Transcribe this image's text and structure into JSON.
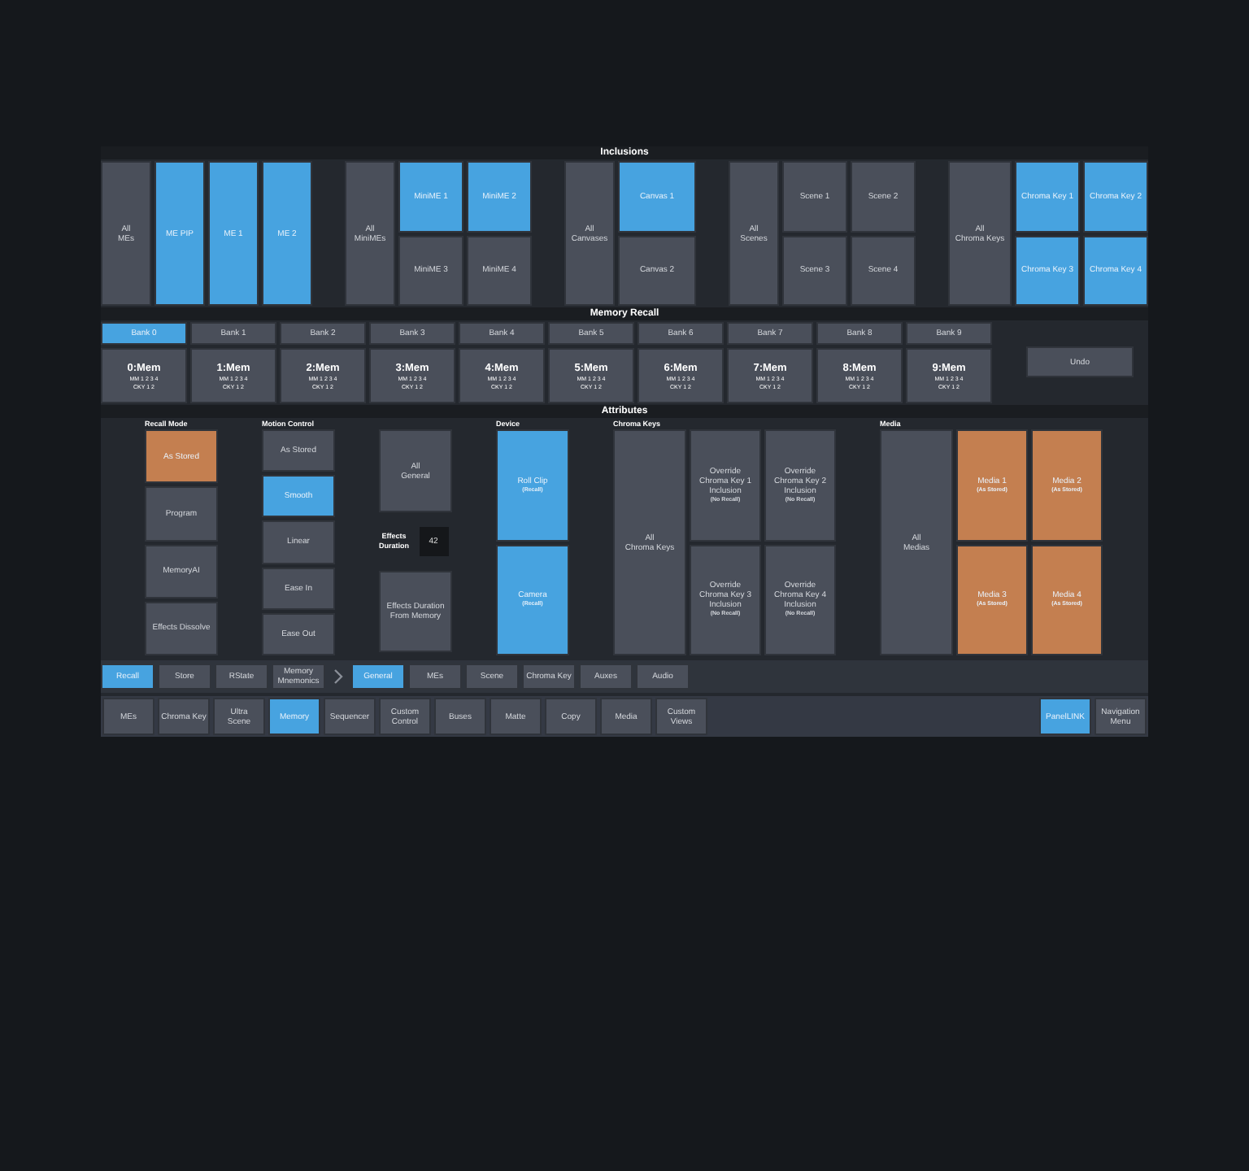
{
  "inclusions": {
    "title": "Inclusions",
    "groups": [
      {
        "kind": "columns",
        "all": "All\nMEs",
        "items": [
          {
            "label": "ME PIP",
            "selected": true
          },
          {
            "label": "ME 1",
            "selected": true
          },
          {
            "label": "ME 2",
            "selected": true
          }
        ]
      },
      {
        "kind": "grid",
        "all": "All\nMiniMEs",
        "items": [
          {
            "label": "MiniME 1",
            "selected": true
          },
          {
            "label": "MiniME 2",
            "selected": true
          },
          {
            "label": "MiniME 3",
            "selected": false
          },
          {
            "label": "MiniME 4",
            "selected": false
          }
        ]
      },
      {
        "kind": "column",
        "all": "All\nCanvases",
        "items": [
          {
            "label": "Canvas 1",
            "selected": true
          },
          {
            "label": "Canvas 2",
            "selected": false
          }
        ]
      },
      {
        "kind": "grid",
        "all": "All\nScenes",
        "items": [
          {
            "label": "Scene 1",
            "selected": false
          },
          {
            "label": "Scene 2",
            "selected": false
          },
          {
            "label": "Scene 3",
            "selected": false
          },
          {
            "label": "Scene 4",
            "selected": false
          }
        ]
      },
      {
        "kind": "grid",
        "all": "All\nChroma Keys",
        "items": [
          {
            "label": "Chroma Key 1",
            "selected": true
          },
          {
            "label": "Chroma Key 2",
            "selected": true
          },
          {
            "label": "Chroma Key 3",
            "selected": true
          },
          {
            "label": "Chroma Key 4",
            "selected": true
          }
        ]
      }
    ]
  },
  "memory_recall": {
    "title": "Memory Recall",
    "banks": [
      {
        "label": "Bank 0",
        "selected": true
      },
      {
        "label": "Bank 1",
        "selected": false
      },
      {
        "label": "Bank 2",
        "selected": false
      },
      {
        "label": "Bank 3",
        "selected": false
      },
      {
        "label": "Bank 4",
        "selected": false
      },
      {
        "label": "Bank 5",
        "selected": false
      },
      {
        "label": "Bank 6",
        "selected": false
      },
      {
        "label": "Bank 7",
        "selected": false
      },
      {
        "label": "Bank 8",
        "selected": false
      },
      {
        "label": "Bank 9",
        "selected": false
      }
    ],
    "memories": [
      {
        "name": "0:Mem",
        "lines": [
          "MM 1 2 3 4",
          "CKY 1 2"
        ]
      },
      {
        "name": "1:Mem",
        "lines": [
          "MM 1 2 3 4",
          "CKY 1 2"
        ]
      },
      {
        "name": "2:Mem",
        "lines": [
          "MM 1 2 3 4",
          "CKY 1 2"
        ]
      },
      {
        "name": "3:Mem",
        "lines": [
          "MM 1 2 3 4",
          "CKY 1 2"
        ]
      },
      {
        "name": "4:Mem",
        "lines": [
          "MM 1 2 3 4",
          "CKY 1 2"
        ]
      },
      {
        "name": "5:Mem",
        "lines": [
          "MM 1 2 3 4",
          "CKY 1 2"
        ]
      },
      {
        "name": "6:Mem",
        "lines": [
          "MM 1 2 3 4",
          "CKY 1 2"
        ]
      },
      {
        "name": "7:Mem",
        "lines": [
          "MM 1 2 3 4",
          "CKY 1 2"
        ]
      },
      {
        "name": "8:Mem",
        "lines": [
          "MM 1 2 3 4",
          "CKY 1 2"
        ]
      },
      {
        "name": "9:Mem",
        "lines": [
          "MM 1 2 3 4",
          "CKY 1 2"
        ]
      }
    ],
    "undo": "Undo"
  },
  "attributes": {
    "title": "Attributes",
    "sections": [
      {
        "kind": "recall_mode",
        "title": "Recall Mode",
        "items": [
          {
            "label": "As Stored",
            "selected": true
          },
          {
            "label": "Program",
            "selected": false
          },
          {
            "label": "MemoryAI",
            "selected": false
          },
          {
            "label": "Effects Dissolve",
            "selected": false
          }
        ]
      },
      {
        "kind": "motion_control",
        "title": "Motion Control",
        "items": [
          {
            "label": "As Stored",
            "selected": false
          },
          {
            "label": "Smooth",
            "selected": true
          },
          {
            "label": "Linear",
            "selected": false
          },
          {
            "label": "Ease In",
            "selected": false
          },
          {
            "label": "Ease Out",
            "selected": false
          }
        ]
      },
      {
        "kind": "general",
        "all": "All\nGeneral",
        "duration_label": "Effects\nDuration",
        "duration_value": "42",
        "from_memory": "Effects Duration\nFrom Memory"
      },
      {
        "kind": "device",
        "title": "Device",
        "items": [
          {
            "label": "Roll Clip",
            "note": "(Recall)",
            "selected": true
          },
          {
            "label": "Camera",
            "note": "(Recall)",
            "selected": true
          }
        ]
      },
      {
        "kind": "chroma_keys",
        "title": "Chroma Keys",
        "all": "All\nChroma Keys",
        "items": [
          {
            "label": "Override\nChroma Key 1\nInclusion",
            "note": "(No Recall)",
            "selected": false
          },
          {
            "label": "Override\nChroma Key 2\nInclusion",
            "note": "(No Recall)",
            "selected": false
          },
          {
            "label": "Override\nChroma Key 3\nInclusion",
            "note": "(No Recall)",
            "selected": false
          },
          {
            "label": "Override\nChroma Key 4\nInclusion",
            "note": "(No Recall)",
            "selected": false
          }
        ]
      },
      {
        "kind": "media",
        "title": "Media",
        "all": "All\nMedias",
        "items": [
          {
            "label": "Media 1",
            "note": "(As Stored)",
            "selected": true
          },
          {
            "label": "Media 2",
            "note": "(As Stored)",
            "selected": true
          },
          {
            "label": "Media 3",
            "note": "(As Stored)",
            "selected": true
          },
          {
            "label": "Media 4",
            "note": "(As Stored)",
            "selected": true
          }
        ]
      }
    ]
  },
  "mode_tabs": [
    {
      "label": "Recall",
      "selected": true
    },
    {
      "label": "Store",
      "selected": false
    },
    {
      "label": "RState",
      "selected": false
    },
    {
      "label": "Memory\nMnemonics",
      "selected": false
    }
  ],
  "category_tabs": [
    {
      "label": "General",
      "selected": true
    },
    {
      "label": "MEs",
      "selected": false
    },
    {
      "label": "Scene",
      "selected": false
    },
    {
      "label": "Chroma Key",
      "selected": false
    },
    {
      "label": "Auxes",
      "selected": false
    },
    {
      "label": "Audio",
      "selected": false
    }
  ],
  "navigation": {
    "left": [
      {
        "label": "MEs",
        "selected": false
      },
      {
        "label": "Chroma Key",
        "selected": false
      },
      {
        "label": "Ultra\nScene",
        "selected": false
      },
      {
        "label": "Memory",
        "selected": true
      },
      {
        "label": "Sequencer",
        "selected": false
      },
      {
        "label": "Custom\nControl",
        "selected": false
      },
      {
        "label": "Buses",
        "selected": false
      },
      {
        "label": "Matte",
        "selected": false
      },
      {
        "label": "Copy",
        "selected": false
      },
      {
        "label": "Media",
        "selected": false
      },
      {
        "label": "Custom\nViews",
        "selected": false
      }
    ],
    "right": [
      {
        "label": "PanelLINK",
        "selected": true
      },
      {
        "label": "Navigation\nMenu",
        "selected": false
      }
    ]
  }
}
